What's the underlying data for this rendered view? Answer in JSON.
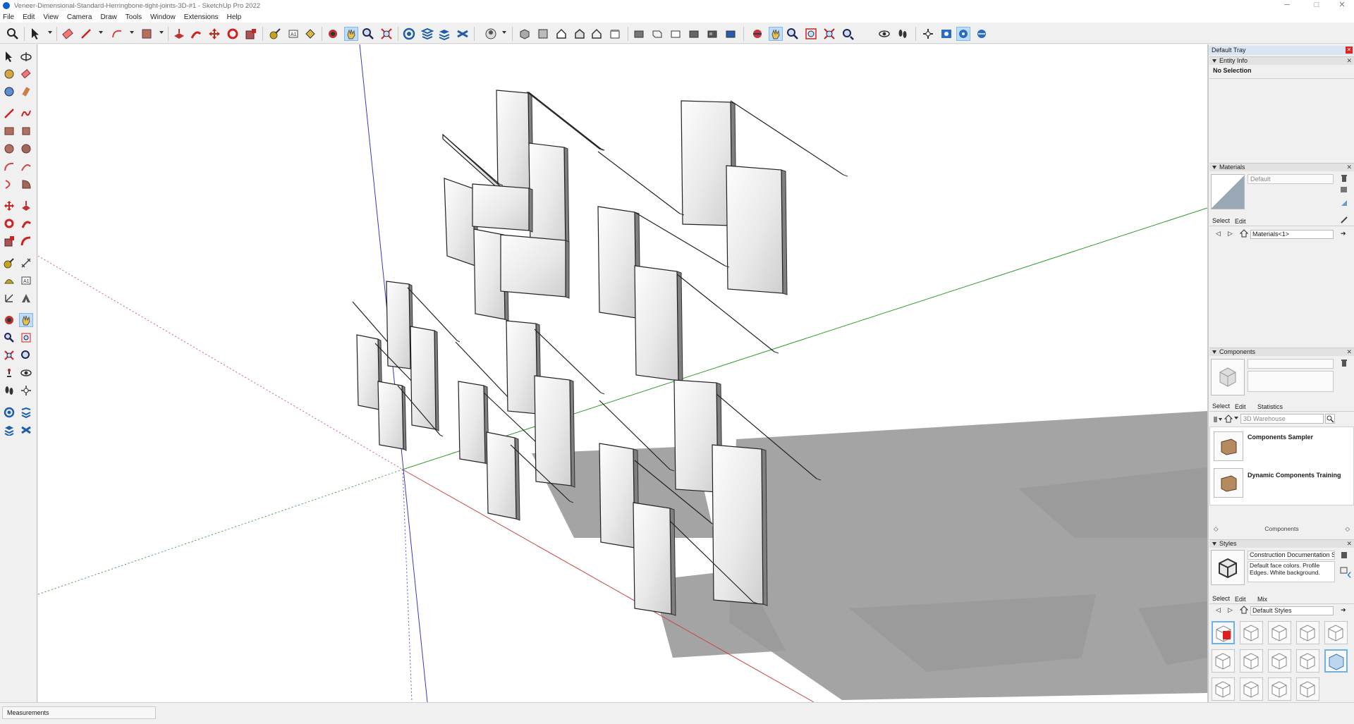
{
  "window": {
    "title": "Veneer-Dimensional-Standard-Herringbone-tight-joints-3D-#1 - SketchUp Pro 2022",
    "minimize": "─",
    "maximize": "□",
    "close": "✕"
  },
  "menu": [
    "File",
    "Edit",
    "View",
    "Camera",
    "Draw",
    "Tools",
    "Window",
    "Extensions",
    "Help"
  ],
  "tray": {
    "title": "Default Tray",
    "entity_info": {
      "header": "Entity Info",
      "status": "No Selection"
    },
    "materials": {
      "header": "Materials",
      "name": "Default",
      "tab_select": "Select",
      "tab_edit": "Edit",
      "collection": "Materials<1>"
    },
    "components": {
      "header": "Components",
      "tab_select": "Select",
      "tab_edit": "Edit",
      "tab_statistics": "Statistics",
      "search_placeholder": "3D Warehouse",
      "items": [
        {
          "name": "Components Sampler"
        },
        {
          "name": "Dynamic Components Training"
        }
      ],
      "footer": "Components"
    },
    "styles": {
      "header": "Styles",
      "name": "Construction Documentation Sty",
      "description": "Default face colors. Profile Edges. White background.",
      "tab_select": "Select",
      "tab_edit": "Edit",
      "tab_mix": "Mix",
      "collection": "Default Styles"
    }
  },
  "status": {
    "measurements_label": "Measurements"
  },
  "colors": {
    "accent": "#0a62c8",
    "selected_tool": "#bfdcf7",
    "red_axis": "#c84848",
    "green_axis": "#2e9a2e",
    "blue_axis": "#3a3ab8",
    "shadow": "#9a9a9a"
  }
}
